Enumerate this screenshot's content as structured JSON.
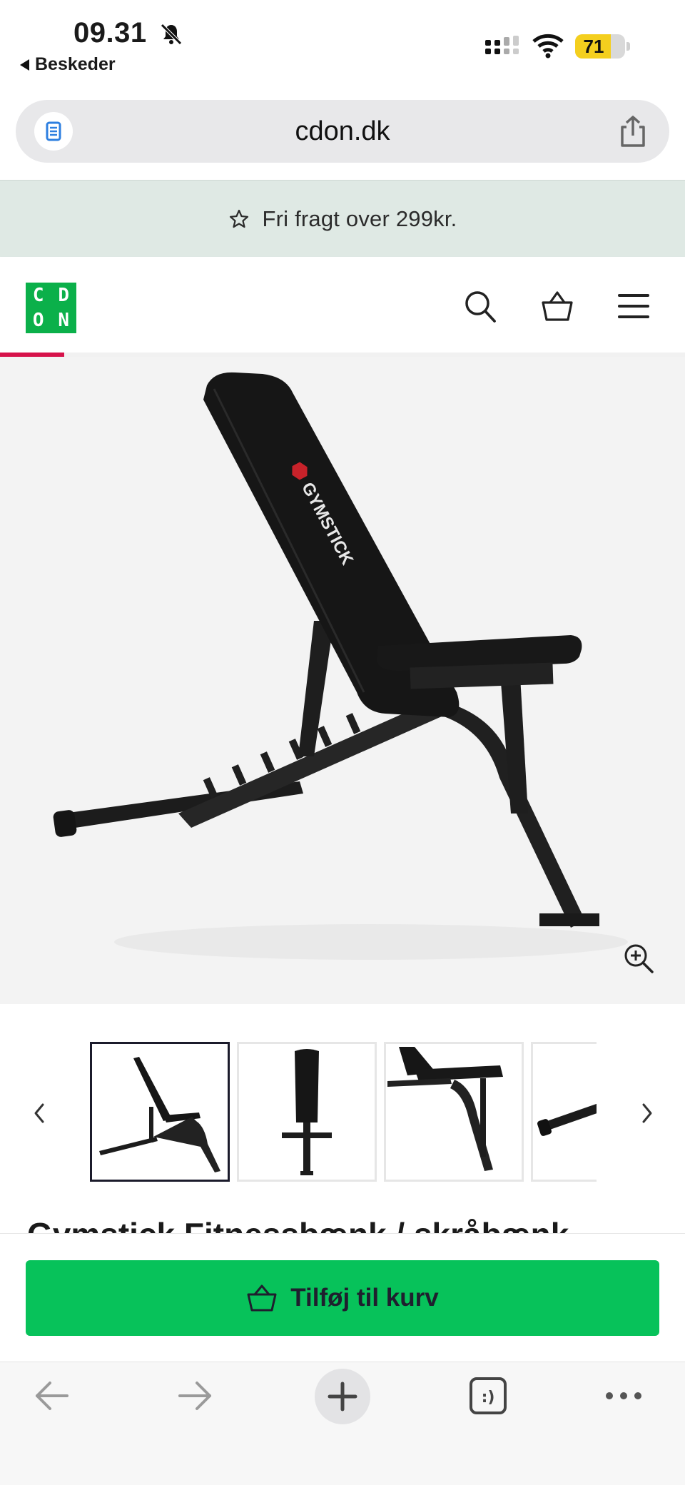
{
  "status_bar": {
    "time": "09.31",
    "back_app": "Beskeder",
    "battery_level": 71,
    "battery_label": "71"
  },
  "browser": {
    "url": "cdon.dk"
  },
  "promo": {
    "text": "Fri fragt over 299kr."
  },
  "site_header": {
    "logo_letters": [
      "C",
      "D",
      "O",
      "N"
    ],
    "brand_color": "#0bb04a",
    "accent_color": "#d6124a"
  },
  "product": {
    "image_brand_text": "GYMSTICK",
    "title_partial": "Gymstick Fitnessbænk / skråbænk",
    "thumbnail_count_visible": 4,
    "active_thumbnail_index": 0
  },
  "cart": {
    "button_label": "Tilføj til kurv",
    "button_color": "#07c25a"
  },
  "icons": {
    "status": [
      "bell-muted-icon",
      "signal-icon",
      "wifi-icon",
      "battery-icon"
    ],
    "browser": [
      "reader-icon",
      "share-icon"
    ],
    "header": [
      "search-icon",
      "basket-icon",
      "menu-icon"
    ],
    "gallery": [
      "zoom-in-icon",
      "chevron-left-icon",
      "chevron-right-icon"
    ],
    "bottom_bar": [
      "back-arrow-icon",
      "forward-arrow-icon",
      "plus-icon",
      "tabs-icon",
      "more-icon"
    ]
  }
}
